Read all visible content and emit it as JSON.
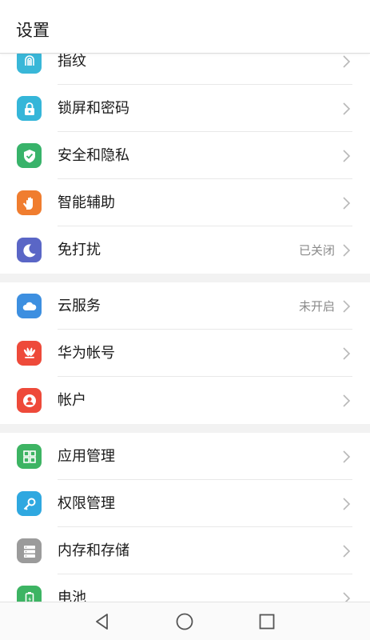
{
  "header": {
    "title": "设置"
  },
  "groups": [
    {
      "items": [
        {
          "label": "指纹",
          "icon": "fingerprint-icon",
          "color": "#39b7d8"
        },
        {
          "label": "锁屏和密码",
          "icon": "lock-icon",
          "color": "#35b6d9"
        },
        {
          "label": "安全和隐私",
          "icon": "shield-icon",
          "color": "#38b36a"
        },
        {
          "label": "智能辅助",
          "icon": "hand-icon",
          "color": "#f07d2f"
        },
        {
          "label": "免打扰",
          "icon": "moon-icon",
          "color": "#5a66c6",
          "value": "已关闭"
        }
      ]
    },
    {
      "items": [
        {
          "label": "云服务",
          "icon": "cloud-icon",
          "color": "#3d8fe0",
          "value": "未开启"
        },
        {
          "label": "华为帐号",
          "icon": "huawei-icon",
          "color": "#ee4a3a"
        },
        {
          "label": "帐户",
          "icon": "account-icon",
          "color": "#ee4a3a"
        }
      ]
    },
    {
      "items": [
        {
          "label": "应用管理",
          "icon": "apps-grid-icon",
          "color": "#3db463"
        },
        {
          "label": "权限管理",
          "icon": "key-icon",
          "color": "#2fa8e0"
        },
        {
          "label": "内存和存储",
          "icon": "storage-icon",
          "color": "#9b9b9b"
        },
        {
          "label": "电池",
          "icon": "battery-icon",
          "color": "#3db463"
        }
      ]
    }
  ],
  "navbar": {
    "back": "back-triangle-icon",
    "home": "home-circle-icon",
    "recents": "recents-square-icon"
  }
}
